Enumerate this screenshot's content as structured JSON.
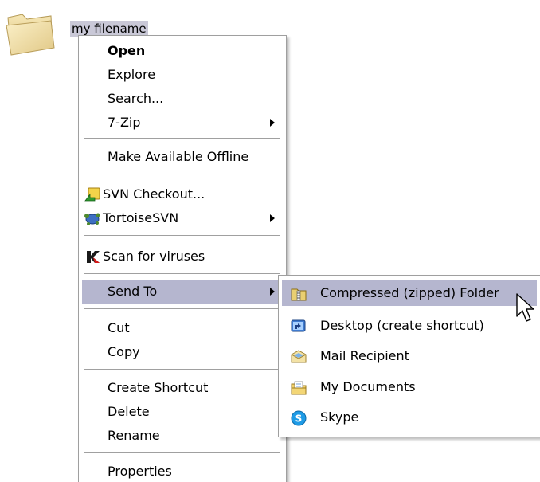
{
  "desktop": {
    "item": {
      "icon": "folder-icon",
      "label": "my filename"
    }
  },
  "context_menu": {
    "items": [
      {
        "label": "Open",
        "bold": true
      },
      {
        "label": "Explore"
      },
      {
        "label": "Search..."
      },
      {
        "label": "7-Zip",
        "submenu": true
      },
      {
        "label": "Make Available Offline"
      },
      {
        "label": "SVN Checkout...",
        "icon": "svn-checkout-icon"
      },
      {
        "label": "TortoiseSVN",
        "icon": "tortoisesvn-icon",
        "submenu": true
      },
      {
        "label": "Scan for viruses",
        "icon": "kaspersky-icon"
      },
      {
        "label": "Send To",
        "submenu": true,
        "highlighted": true
      },
      {
        "label": "Cut"
      },
      {
        "label": "Copy"
      },
      {
        "label": "Create Shortcut"
      },
      {
        "label": "Delete"
      },
      {
        "label": "Rename"
      },
      {
        "label": "Properties"
      }
    ]
  },
  "send_to_menu": {
    "items": [
      {
        "label": "Compressed (zipped) Folder",
        "icon": "zip-folder-icon",
        "highlighted": true
      },
      {
        "label": "Desktop (create shortcut)",
        "icon": "desktop-shortcut-icon"
      },
      {
        "label": "Mail Recipient",
        "icon": "mail-recipient-icon"
      },
      {
        "label": "My Documents",
        "icon": "my-documents-icon"
      },
      {
        "label": "Skype",
        "icon": "skype-icon"
      }
    ]
  },
  "colors": {
    "highlight": "#b5b6cf",
    "selection_label": "#c9c8d7",
    "menu_border": "#9f9f9f"
  },
  "cursor": {
    "icon": "arrow-cursor-icon"
  }
}
